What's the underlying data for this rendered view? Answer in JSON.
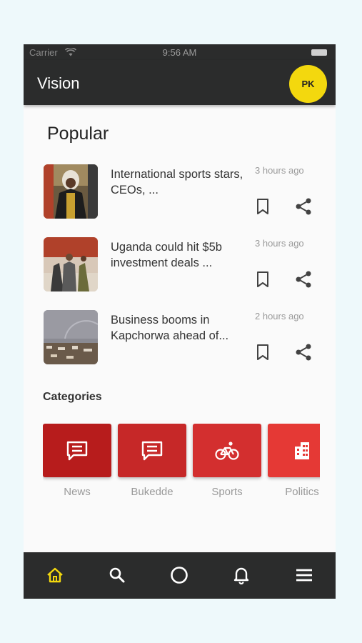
{
  "status_bar": {
    "carrier": "Carrier",
    "time": "9:56 AM"
  },
  "app_bar": {
    "title": "Vision",
    "avatar_initials": "PK"
  },
  "popular": {
    "title": "Popular",
    "articles": [
      {
        "title": "International sports stars, CEOs, ...",
        "time": "3 hours ago"
      },
      {
        "title": "Uganda could hit $5b investment deals ...",
        "time": "3 hours ago"
      },
      {
        "title": "Business booms in Kapchorwa ahead of...",
        "time": "2 hours ago"
      }
    ]
  },
  "categories": {
    "title": "Categories",
    "items": [
      {
        "label": "News",
        "icon": "comment-icon",
        "color": "#b71c1c"
      },
      {
        "label": "Bukedde",
        "icon": "comment-icon",
        "color": "#c62828"
      },
      {
        "label": "Sports",
        "icon": "bicycle-icon",
        "color": "#d32f2f"
      },
      {
        "label": "Politics",
        "icon": "building-icon",
        "color": "#e53935"
      }
    ]
  },
  "bottom_nav": [
    {
      "name": "home",
      "icon": "home-icon",
      "active": true
    },
    {
      "name": "search",
      "icon": "search-icon",
      "active": false
    },
    {
      "name": "circle",
      "icon": "circle-icon",
      "active": false
    },
    {
      "name": "notifications",
      "icon": "bell-icon",
      "active": false
    },
    {
      "name": "menu",
      "icon": "menu-icon",
      "active": false
    }
  ],
  "colors": {
    "bar": "#2b2c2c",
    "accent": "#f3d80e",
    "active_nav": "#f3d80e",
    "nav_icon": "#ffffff"
  }
}
